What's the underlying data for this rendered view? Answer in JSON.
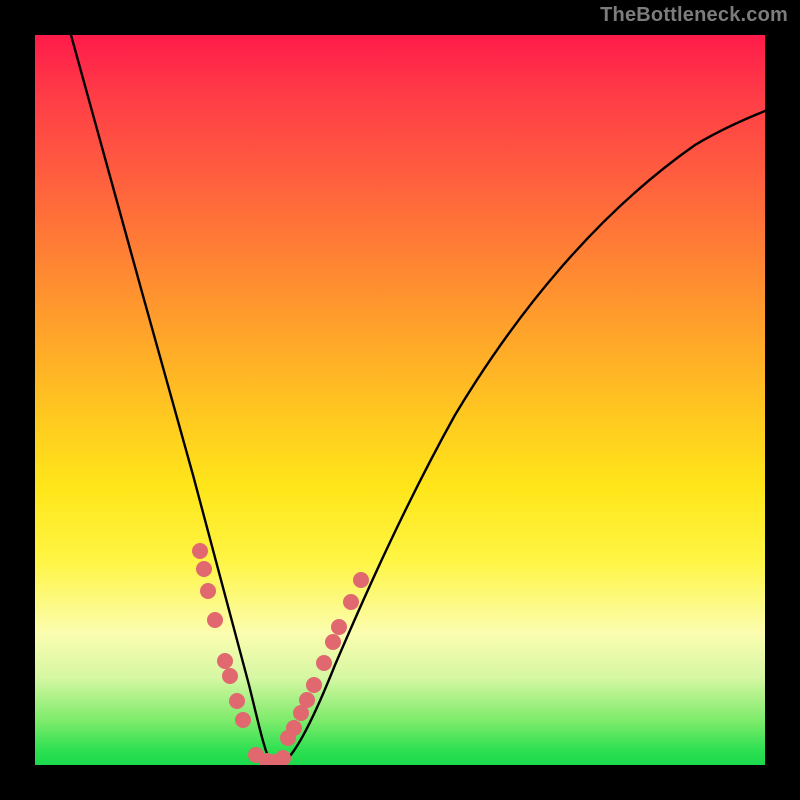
{
  "watermark": "TheBottleneck.com",
  "chart_data": {
    "type": "line",
    "title": "",
    "xlabel": "",
    "ylabel": "",
    "xlim": [
      0,
      100
    ],
    "ylim": [
      0,
      100
    ],
    "series": [
      {
        "name": "bottleneck-curve",
        "x": [
          5,
          8,
          11,
          14,
          17,
          20,
          22,
          24,
          26,
          28,
          29,
          30,
          31,
          32,
          34,
          36,
          38,
          40,
          44,
          50,
          58,
          68,
          80,
          92,
          100
        ],
        "y": [
          100,
          90,
          78,
          65,
          52,
          40,
          32,
          24,
          16,
          9,
          5,
          2,
          0,
          0,
          2,
          5,
          9,
          14,
          24,
          37,
          52,
          66,
          77,
          84,
          88
        ]
      },
      {
        "name": "highlight-dots-left",
        "x": [
          22.4,
          23.0,
          23.6,
          24.6,
          26.0,
          26.6,
          27.6,
          28.4
        ],
        "y": [
          29.5,
          27.0,
          24.0,
          20.0,
          14.0,
          12.0,
          8.5,
          6.0
        ]
      },
      {
        "name": "highlight-dots-bottom",
        "x": [
          30.2,
          31.0,
          32.0,
          33.0
        ],
        "y": [
          1.2,
          0.4,
          0.3,
          0.7
        ]
      },
      {
        "name": "highlight-dots-right",
        "x": [
          34.6,
          35.4,
          36.4,
          37.2,
          38.2,
          39.6,
          40.8,
          41.6,
          43.2,
          44.6
        ],
        "y": [
          3.8,
          5.2,
          7.2,
          9.0,
          11.0,
          14.0,
          17.0,
          19.0,
          22.5,
          25.5
        ]
      }
    ],
    "colors": {
      "curve": "#000000",
      "dots": "#e0686e"
    }
  }
}
